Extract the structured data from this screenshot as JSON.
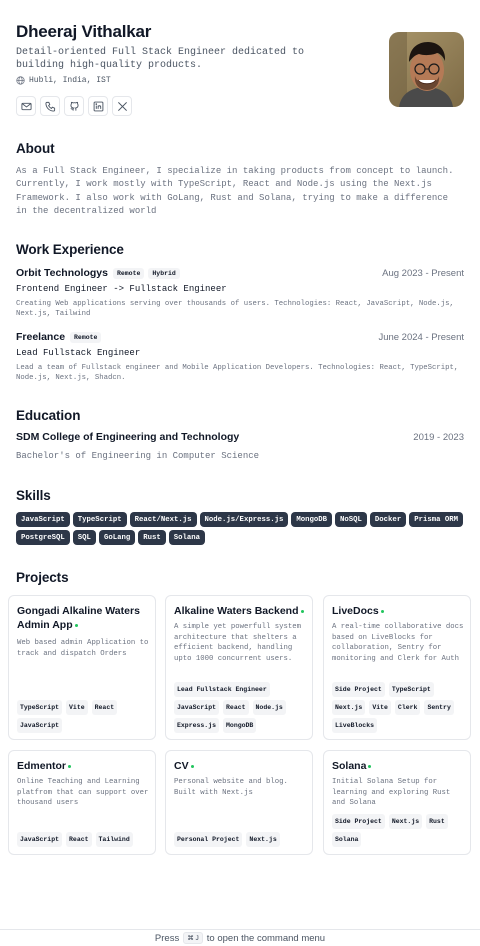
{
  "profile": {
    "name": "Dheeraj Vithalkar",
    "tagline": "Detail-oriented Full Stack Engineer dedicated to building high-quality products.",
    "location": "Hubli, India, IST",
    "social": [
      {
        "name": "email",
        "icon": "mail-icon"
      },
      {
        "name": "phone",
        "icon": "phone-icon"
      },
      {
        "name": "github",
        "icon": "github-icon"
      },
      {
        "name": "linkedin",
        "icon": "linkedin-icon"
      },
      {
        "name": "x",
        "icon": "x-icon"
      }
    ]
  },
  "about": {
    "heading": "About",
    "text": "As a Full Stack Engineer, I specialize in taking products from concept to launch. Currently, I work mostly with TypeScript, React and Node.js using the Next.js Framework. I also work with GoLang, Rust and Solana, trying to make a difference in the decentralized world"
  },
  "work": {
    "heading": "Work Experience",
    "jobs": [
      {
        "company": "Orbit Technologys",
        "badges": [
          "Remote",
          "Hybrid"
        ],
        "dates": "Aug 2023 - Present",
        "role": "Frontend Engineer -> Fullstack Engineer",
        "description": "Creating Web applications serving over thousands of users. Technologies: React, JavaScript, Node.js, Next.js, Tailwind"
      },
      {
        "company": "Freelance",
        "badges": [
          "Remote"
        ],
        "dates": "June 2024 - Present",
        "role": "Lead Fullstack Engineer",
        "description": "Lead a team of Fullstack engineer and Mobile Application Developers. Technologies: React, TypeScript, Node.js, Next.js, Shadcn."
      }
    ]
  },
  "education": {
    "heading": "Education",
    "school": "SDM College of Engineering and Technology",
    "dates": "2019 - 2023",
    "degree": "Bachelor's of Engineering in Computer Science"
  },
  "skills": {
    "heading": "Skills",
    "items": [
      "JavaScript",
      "TypeScript",
      "React/Next.js",
      "Node.js/Express.js",
      "MongoDB",
      "NoSQL",
      "Docker",
      "Prisma ORM",
      "PostgreSQL",
      "SQL",
      "GoLang",
      "Rust",
      "Solana"
    ]
  },
  "projects": {
    "heading": "Projects",
    "items": [
      {
        "title": "Gongadi Alkaline Waters Admin App",
        "description": "Web based admin Application to track and dispatch Orders",
        "tags": [
          "TypeScript",
          "Vite",
          "React",
          "JavaScript"
        ]
      },
      {
        "title": "Alkaline Waters Backend",
        "description": "A simple yet powerfull system architecture that shelters a efficient backend, handling upto 1000 concurrent users.",
        "tags": [
          "Lead Fullstack Engineer",
          "JavaScript",
          "React",
          "Node.js",
          "Express.js",
          "MongoDB"
        ]
      },
      {
        "title": "LiveDocs",
        "description": "A real-time collaborative docs based on LiveBlocks for collaboration, Sentry for monitoring and Clerk for Auth",
        "tags": [
          "Side Project",
          "TypeScript",
          "Next.js",
          "Vite",
          "Clerk",
          "Sentry",
          "LiveBlocks"
        ]
      },
      {
        "title": "Edmentor",
        "description": "Online Teaching and Learning platfrom that can support over thousand users",
        "tags": [
          "JavaScript",
          "React",
          "Tailwind"
        ]
      },
      {
        "title": "CV",
        "description": "Personal website and blog. Built with Next.js",
        "tags": [
          "Personal Project",
          "Next.js"
        ]
      },
      {
        "title": "Solana",
        "description": "Initial Solana Setup for learning and exploring Rust and Solana",
        "tags": [
          "Side Project",
          "Next.js",
          "Rust",
          "Solana"
        ]
      }
    ]
  },
  "command_bar": {
    "prefix": "Press",
    "shortcut": "⌘ J",
    "suffix": "to open the command menu"
  },
  "colors": {
    "skill_bg": "#2d3748",
    "badge_bg": "#f3f4f6",
    "status_dot": "#22c55e",
    "muted_text": "#6b7280"
  }
}
